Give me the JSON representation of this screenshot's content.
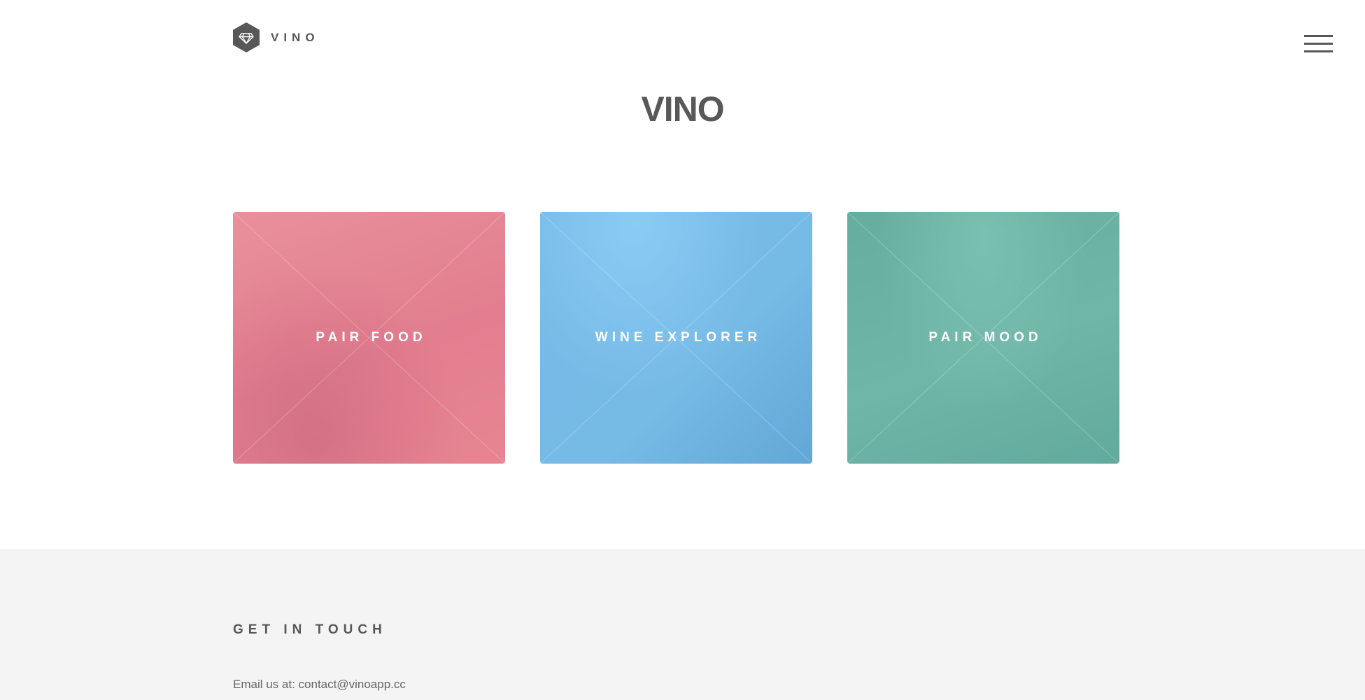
{
  "header": {
    "logo_text": "VINO",
    "logo_icon": "diamond-icon",
    "menu_icon": "hamburger-menu-icon"
  },
  "main": {
    "title": "VINO",
    "tiles": [
      {
        "label": "PAIR FOOD",
        "color": "#e4848f"
      },
      {
        "label": "WINE EXPLORER",
        "color": "#76bae6"
      },
      {
        "label": "PAIR MOOD",
        "color": "#6cb2a4"
      }
    ]
  },
  "footer": {
    "heading": "GET IN TOUCH",
    "email_prefix": "Email us at: ",
    "email": "contact@vinoapp.cc"
  },
  "colors": {
    "text": "#585858",
    "footer_bg": "#f4f4f4",
    "page_bg": "#ffffff"
  }
}
